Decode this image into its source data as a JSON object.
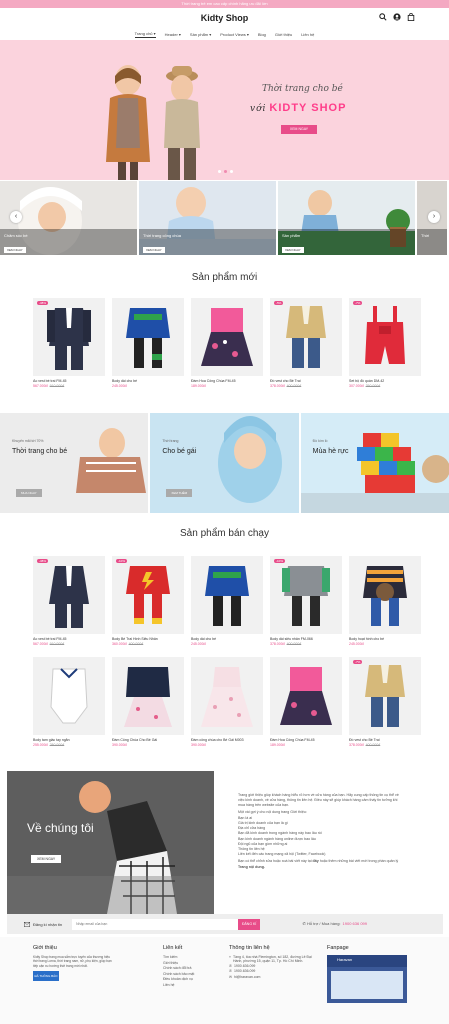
{
  "topbar": {
    "text": "Thời trang trẻ em cao cấp chính hãng ưu đãi lớn"
  },
  "header": {
    "logo": "Kidty Shop"
  },
  "nav": [
    "Trang chủ",
    "Header",
    "Sản phẩm",
    "Product Views",
    "Blog",
    "Giới thiệu",
    "Liên hệ"
  ],
  "hero": {
    "script": "Thời trang cho bé",
    "brand_prefix": "với",
    "brand": "KIDTY SHOP",
    "button": "XEM NGAY"
  },
  "categories": [
    {
      "title": "Chăm sóc bé",
      "button": "XEM NGAY"
    },
    {
      "title": "Thời trang công chúa",
      "button": "XEM NGAY"
    },
    {
      "title": "Sản phẩm",
      "button": "XEM NGAY"
    },
    {
      "title": "Thời",
      "button": ""
    }
  ],
  "new_products": {
    "title": "Sản phẩm mới",
    "items": [
      {
        "name": "Áo vest bé trai FM-45",
        "price": "567.000đ",
        "old": "910.000đ",
        "badge": "-38%"
      },
      {
        "name": "Body dài cho bé",
        "price": "245.000đ",
        "old": "",
        "badge": ""
      },
      {
        "name": "Đầm Hoa Công Chúa FM-45",
        "price": "189.000đ",
        "old": "",
        "badge": ""
      },
      {
        "name": "Đồ vest cho Bé Trai",
        "price": "378.000đ",
        "old": "400.000đ",
        "badge": "-5%"
      },
      {
        "name": "Set bộ đồ quần DM-42",
        "price": "307.000đ",
        "old": "350.000đ",
        "badge": "-7%"
      }
    ]
  },
  "banners": [
    {
      "sub": "Khuyến mãi tới 70%",
      "title": "Thời trang cho bé",
      "button": "MUA NGAY"
    },
    {
      "sub": "Thời trang",
      "title": "Cho bé gái",
      "button": "XEM THÊM"
    },
    {
      "sub": "Đồ kìm lồ",
      "title": "Mùa hè rực",
      "button": ""
    }
  ],
  "best_sellers": {
    "title": "Sản phẩm bán chạy",
    "row1": [
      {
        "name": "Áo vest bé trai FM-45",
        "price": "567.000đ",
        "old": "910.000đ",
        "badge": "-38%"
      },
      {
        "name": "Body Bé Trai Hình Siêu Nhân",
        "price": "360.000đ",
        "old": "400.000đ",
        "badge": "-10%"
      },
      {
        "name": "Body dài cho bé",
        "price": "245.000đ",
        "old": "",
        "badge": ""
      },
      {
        "name": "Body dài siêu nhân FM-066",
        "price": "378.000đ",
        "old": "400.000đ",
        "badge": "-10%"
      },
      {
        "name": "Body hoạt hình cho bé",
        "price": "245.000đ",
        "old": "",
        "badge": ""
      }
    ],
    "row2": [
      {
        "name": "Body tam giác tay ngắn",
        "price": "255.000đ",
        "old": "280.000đ",
        "badge": ""
      },
      {
        "name": "Đầm Công Chúa Cho Bé Gái",
        "price": "390.000đ",
        "old": "",
        "badge": ""
      },
      {
        "name": "Đầm công chúa cho Bé Gái M003",
        "price": "390.000đ",
        "old": "",
        "badge": ""
      },
      {
        "name": "Đầm Hoa Công Chúa FM-45",
        "price": "189.000đ",
        "old": "",
        "badge": ""
      },
      {
        "name": "Đồ vest cho Bé Trai",
        "price": "378.000đ",
        "old": "400.000đ",
        "badge": "-7%"
      }
    ]
  },
  "about": {
    "title": "Về chúng tôi",
    "button": "XEM NGAY",
    "p1": "Trang giới thiệu giúp khách hàng hiểu rõ hơn về cửa hàng của bạn. Hãy cung cấp thông tin cụ thể về việc kinh doanh, về cửa hàng, thông tin liên hệ. Điều này sẽ giúp khách hàng cảm thấy tin tưởng khi mua hàng trên website của bạn.",
    "p2": "Một vài gợi ý cho nội dung trang Giới thiệu:",
    "list": [
      "Bạn là ai",
      "Giá trị kinh doanh của bạn là gì",
      "Địa chỉ cửa hàng",
      "Bạn đã kinh doanh trong ngành hàng này bao lâu rồi",
      "Bạn kinh doanh ngành hàng online được bao lâu",
      "Đội ngũ của bạn gồm những ai",
      "Thông tin liên hệ",
      "Liên kết đến các trang mạng xã hội (Twitter, Facebook)"
    ],
    "p3a": "Bạn có thể chỉnh sửa hoặc xoá bài viết này tại",
    "p3b": "đây",
    "p3c": "hoặc thêm những bài viết mới trong phần quản lý",
    "p3d": "Trang nội dung."
  },
  "newsletter": {
    "label": "Đăng kí nhận tin",
    "placeholder": "Nhập email của bạn",
    "button": "ĐĂNG KÍ",
    "hotline_label": "Hỗ trợ / Mua hàng:",
    "hotline": "1900 636 099"
  },
  "footer": {
    "about_title": "Giới thiệu",
    "about_text": "Kidty Shop trang mua sắm trực tuyến của thương hiệu thời trang Lorna, thời trang nam, nữ, phụ kiện, giúp bạn tiếp cận xu hướng thời trang mới nhất.",
    "bct": "ĐÃ THÔNG BÁO",
    "links_title": "Liên kết",
    "links": [
      "Tìm kiếm",
      "Giới thiệu",
      "Chính sách đổi trả",
      "Chính sách bảo mật",
      "Điều khoản dịch vụ",
      "Liên hệ"
    ],
    "contact_title": "Thông tin liên hệ",
    "address": "Tầng 4, tòa nhà Flemington, số 182, đường Lê Đại Hành, phường 15, quận 11, Tp. Hồ Chí Minh.",
    "phone1": "1900.636.099",
    "phone2": "1900.636.099",
    "email": "hi@haravan.com",
    "fanpage_title": "Fanpage",
    "fanpage_name": "Haravan"
  },
  "colors": {
    "accent": "#e84c89",
    "hero_bg": "#fbd3dd"
  }
}
